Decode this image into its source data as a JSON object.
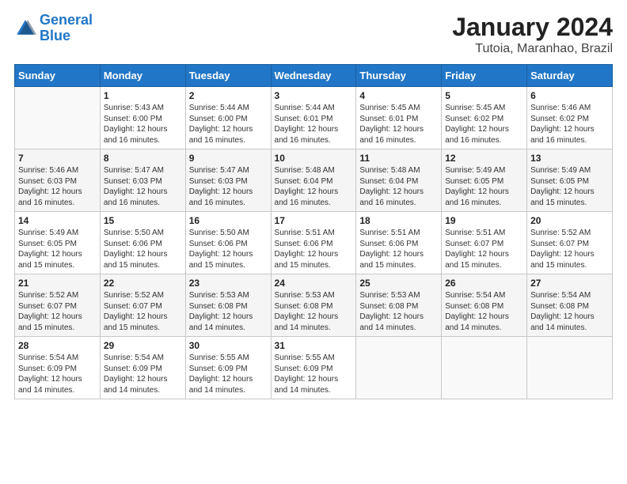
{
  "header": {
    "logo_line1": "General",
    "logo_line2": "Blue",
    "title": "January 2024",
    "subtitle": "Tutoia, Maranhao, Brazil"
  },
  "days_of_week": [
    "Sunday",
    "Monday",
    "Tuesday",
    "Wednesday",
    "Thursday",
    "Friday",
    "Saturday"
  ],
  "weeks": [
    [
      {
        "day": "",
        "info": ""
      },
      {
        "day": "1",
        "info": "Sunrise: 5:43 AM\nSunset: 6:00 PM\nDaylight: 12 hours\nand 16 minutes."
      },
      {
        "day": "2",
        "info": "Sunrise: 5:44 AM\nSunset: 6:00 PM\nDaylight: 12 hours\nand 16 minutes."
      },
      {
        "day": "3",
        "info": "Sunrise: 5:44 AM\nSunset: 6:01 PM\nDaylight: 12 hours\nand 16 minutes."
      },
      {
        "day": "4",
        "info": "Sunrise: 5:45 AM\nSunset: 6:01 PM\nDaylight: 12 hours\nand 16 minutes."
      },
      {
        "day": "5",
        "info": "Sunrise: 5:45 AM\nSunset: 6:02 PM\nDaylight: 12 hours\nand 16 minutes."
      },
      {
        "day": "6",
        "info": "Sunrise: 5:46 AM\nSunset: 6:02 PM\nDaylight: 12 hours\nand 16 minutes."
      }
    ],
    [
      {
        "day": "7",
        "info": "Sunrise: 5:46 AM\nSunset: 6:03 PM\nDaylight: 12 hours\nand 16 minutes."
      },
      {
        "day": "8",
        "info": "Sunrise: 5:47 AM\nSunset: 6:03 PM\nDaylight: 12 hours\nand 16 minutes."
      },
      {
        "day": "9",
        "info": "Sunrise: 5:47 AM\nSunset: 6:03 PM\nDaylight: 12 hours\nand 16 minutes."
      },
      {
        "day": "10",
        "info": "Sunrise: 5:48 AM\nSunset: 6:04 PM\nDaylight: 12 hours\nand 16 minutes."
      },
      {
        "day": "11",
        "info": "Sunrise: 5:48 AM\nSunset: 6:04 PM\nDaylight: 12 hours\nand 16 minutes."
      },
      {
        "day": "12",
        "info": "Sunrise: 5:49 AM\nSunset: 6:05 PM\nDaylight: 12 hours\nand 16 minutes."
      },
      {
        "day": "13",
        "info": "Sunrise: 5:49 AM\nSunset: 6:05 PM\nDaylight: 12 hours\nand 15 minutes."
      }
    ],
    [
      {
        "day": "14",
        "info": "Sunrise: 5:49 AM\nSunset: 6:05 PM\nDaylight: 12 hours\nand 15 minutes."
      },
      {
        "day": "15",
        "info": "Sunrise: 5:50 AM\nSunset: 6:06 PM\nDaylight: 12 hours\nand 15 minutes."
      },
      {
        "day": "16",
        "info": "Sunrise: 5:50 AM\nSunset: 6:06 PM\nDaylight: 12 hours\nand 15 minutes."
      },
      {
        "day": "17",
        "info": "Sunrise: 5:51 AM\nSunset: 6:06 PM\nDaylight: 12 hours\nand 15 minutes."
      },
      {
        "day": "18",
        "info": "Sunrise: 5:51 AM\nSunset: 6:06 PM\nDaylight: 12 hours\nand 15 minutes."
      },
      {
        "day": "19",
        "info": "Sunrise: 5:51 AM\nSunset: 6:07 PM\nDaylight: 12 hours\nand 15 minutes."
      },
      {
        "day": "20",
        "info": "Sunrise: 5:52 AM\nSunset: 6:07 PM\nDaylight: 12 hours\nand 15 minutes."
      }
    ],
    [
      {
        "day": "21",
        "info": "Sunrise: 5:52 AM\nSunset: 6:07 PM\nDaylight: 12 hours\nand 15 minutes."
      },
      {
        "day": "22",
        "info": "Sunrise: 5:52 AM\nSunset: 6:07 PM\nDaylight: 12 hours\nand 15 minutes."
      },
      {
        "day": "23",
        "info": "Sunrise: 5:53 AM\nSunset: 6:08 PM\nDaylight: 12 hours\nand 14 minutes."
      },
      {
        "day": "24",
        "info": "Sunrise: 5:53 AM\nSunset: 6:08 PM\nDaylight: 12 hours\nand 14 minutes."
      },
      {
        "day": "25",
        "info": "Sunrise: 5:53 AM\nSunset: 6:08 PM\nDaylight: 12 hours\nand 14 minutes."
      },
      {
        "day": "26",
        "info": "Sunrise: 5:54 AM\nSunset: 6:08 PM\nDaylight: 12 hours\nand 14 minutes."
      },
      {
        "day": "27",
        "info": "Sunrise: 5:54 AM\nSunset: 6:08 PM\nDaylight: 12 hours\nand 14 minutes."
      }
    ],
    [
      {
        "day": "28",
        "info": "Sunrise: 5:54 AM\nSunset: 6:09 PM\nDaylight: 12 hours\nand 14 minutes."
      },
      {
        "day": "29",
        "info": "Sunrise: 5:54 AM\nSunset: 6:09 PM\nDaylight: 12 hours\nand 14 minutes."
      },
      {
        "day": "30",
        "info": "Sunrise: 5:55 AM\nSunset: 6:09 PM\nDaylight: 12 hours\nand 14 minutes."
      },
      {
        "day": "31",
        "info": "Sunrise: 5:55 AM\nSunset: 6:09 PM\nDaylight: 12 hours\nand 14 minutes."
      },
      {
        "day": "",
        "info": ""
      },
      {
        "day": "",
        "info": ""
      },
      {
        "day": "",
        "info": ""
      }
    ]
  ]
}
